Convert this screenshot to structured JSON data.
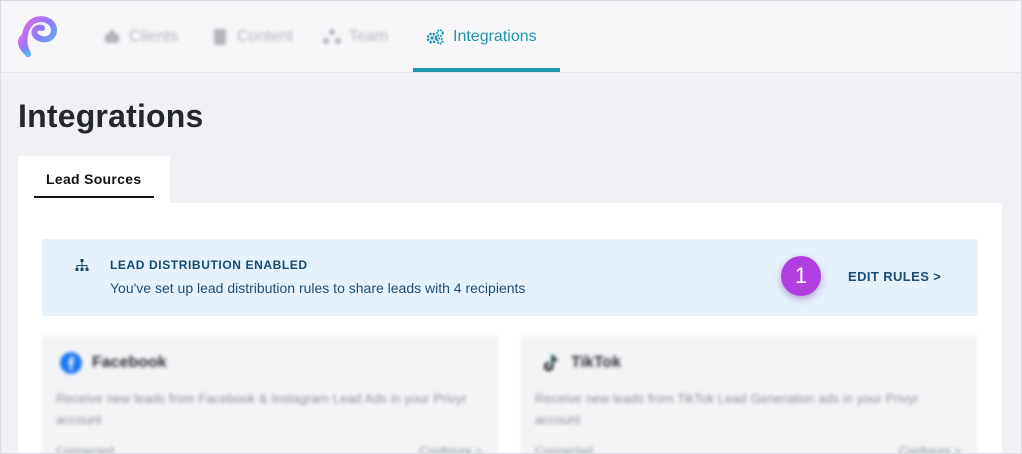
{
  "nav": {
    "items": [
      {
        "label": "Clients",
        "icon": "clients-icon"
      },
      {
        "label": "Content",
        "icon": "content-icon"
      },
      {
        "label": "Team",
        "icon": "team-icon"
      },
      {
        "label": "Integrations",
        "icon": "gears-icon"
      }
    ],
    "active": "Integrations",
    "accent_color": "#1c97ad"
  },
  "page": {
    "title": "Integrations",
    "tab_label": "Lead Sources"
  },
  "banner": {
    "title": "LEAD DISTRIBUTION ENABLED",
    "text": "You've set up lead distribution rules to share leads with 4 recipients",
    "action": "EDIT RULES >",
    "background_color": "#e6f2fb"
  },
  "step_badge": {
    "number": "1",
    "color": "#b13fe0"
  },
  "cards": [
    {
      "title": "Facebook",
      "description": "Receive new leads from Facebook & Instagram Lead Ads in your Privyr account",
      "status": "Connected",
      "action": "Configure >"
    },
    {
      "title": "TikTok",
      "description": "Receive new leads from TikTok Lead Generation ads in your Privyr account",
      "status": "Connected",
      "action": "Configure >"
    }
  ]
}
